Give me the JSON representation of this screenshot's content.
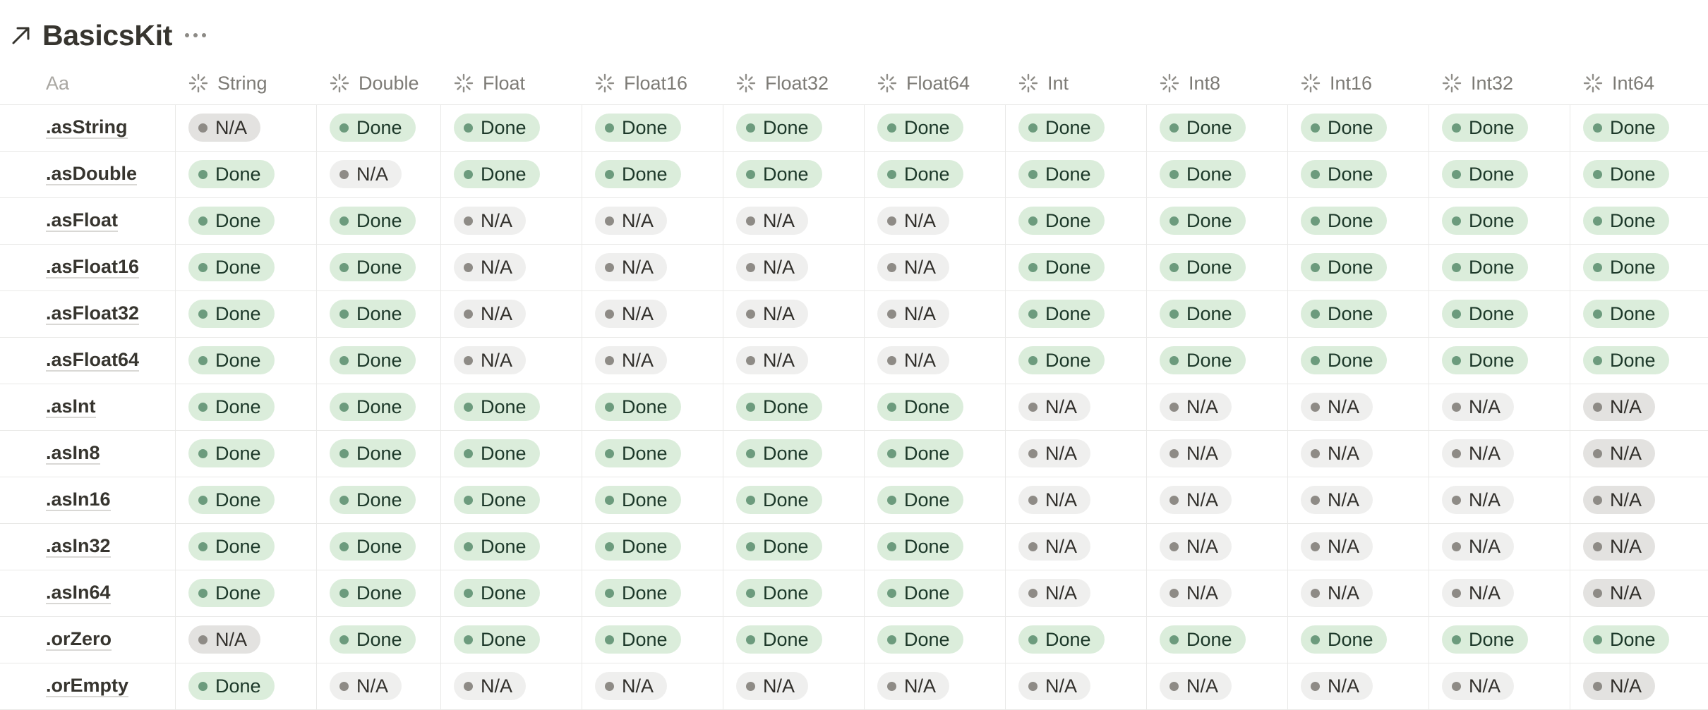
{
  "page": {
    "title": "BasicsKit",
    "title_icon": "north-east-arrow-icon",
    "more_icon": "ellipsis-icon"
  },
  "table": {
    "name_header": "Aa",
    "status_icon": "loading-spinner-icon",
    "columns": [
      "String",
      "Double",
      "Float",
      "Float16",
      "Float32",
      "Float64",
      "Int",
      "Int8",
      "Int16",
      "Int32",
      "Int64"
    ],
    "status_labels": {
      "done": "Done",
      "na": "N/A"
    },
    "rows": [
      {
        "name": ".asString",
        "values": [
          "N/A",
          "Done",
          "Done",
          "Done",
          "Done",
          "Done",
          "Done",
          "Done",
          "Done",
          "Done",
          "Done"
        ]
      },
      {
        "name": ".asDouble",
        "values": [
          "Done",
          "N/A",
          "Done",
          "Done",
          "Done",
          "Done",
          "Done",
          "Done",
          "Done",
          "Done",
          "Done"
        ]
      },
      {
        "name": ".asFloat",
        "values": [
          "Done",
          "Done",
          "N/A",
          "N/A",
          "N/A",
          "N/A",
          "Done",
          "Done",
          "Done",
          "Done",
          "Done"
        ]
      },
      {
        "name": ".asFloat16",
        "values": [
          "Done",
          "Done",
          "N/A",
          "N/A",
          "N/A",
          "N/A",
          "Done",
          "Done",
          "Done",
          "Done",
          "Done"
        ]
      },
      {
        "name": ".asFloat32",
        "values": [
          "Done",
          "Done",
          "N/A",
          "N/A",
          "N/A",
          "N/A",
          "Done",
          "Done",
          "Done",
          "Done",
          "Done"
        ]
      },
      {
        "name": ".asFloat64",
        "values": [
          "Done",
          "Done",
          "N/A",
          "N/A",
          "N/A",
          "N/A",
          "Done",
          "Done",
          "Done",
          "Done",
          "Done"
        ]
      },
      {
        "name": ".asInt",
        "values": [
          "Done",
          "Done",
          "Done",
          "Done",
          "Done",
          "Done",
          "N/A",
          "N/A",
          "N/A",
          "N/A",
          "N/A"
        ]
      },
      {
        "name": ".asIn8",
        "values": [
          "Done",
          "Done",
          "Done",
          "Done",
          "Done",
          "Done",
          "N/A",
          "N/A",
          "N/A",
          "N/A",
          "N/A"
        ]
      },
      {
        "name": ".asIn16",
        "values": [
          "Done",
          "Done",
          "Done",
          "Done",
          "Done",
          "Done",
          "N/A",
          "N/A",
          "N/A",
          "N/A",
          "N/A"
        ]
      },
      {
        "name": ".asIn32",
        "values": [
          "Done",
          "Done",
          "Done",
          "Done",
          "Done",
          "Done",
          "N/A",
          "N/A",
          "N/A",
          "N/A",
          "N/A"
        ]
      },
      {
        "name": ".asIn64",
        "values": [
          "Done",
          "Done",
          "Done",
          "Done",
          "Done",
          "Done",
          "N/A",
          "N/A",
          "N/A",
          "N/A",
          "N/A"
        ]
      },
      {
        "name": ".orZero",
        "values": [
          "N/A",
          "Done",
          "Done",
          "Done",
          "Done",
          "Done",
          "Done",
          "Done",
          "Done",
          "Done",
          "Done"
        ]
      },
      {
        "name": ".orEmpty",
        "values": [
          "Done",
          "N/A",
          "N/A",
          "N/A",
          "N/A",
          "N/A",
          "N/A",
          "N/A",
          "N/A",
          "N/A",
          "N/A"
        ]
      }
    ]
  }
}
